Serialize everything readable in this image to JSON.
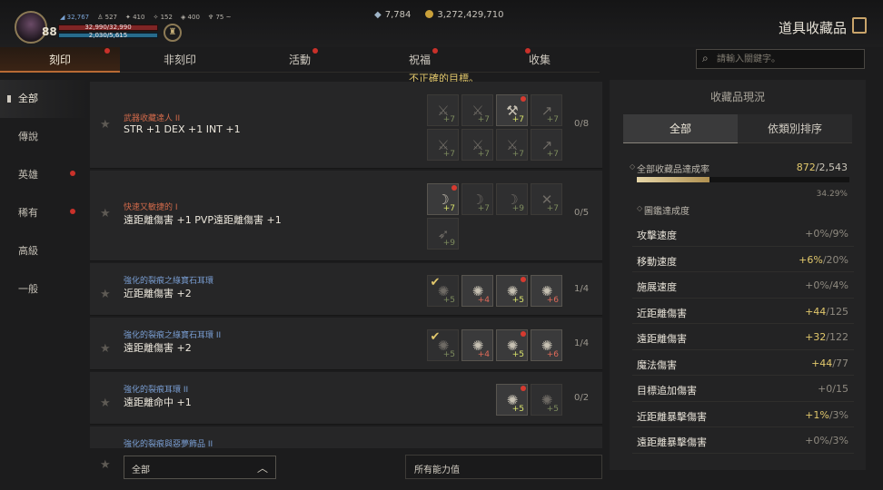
{
  "player": {
    "level": "88",
    "combat_power": "32,767",
    "stats": [
      "527",
      "410",
      "152",
      "400",
      "75 ~"
    ],
    "hp": "32,990/32,990",
    "mp": "2,030/5,615"
  },
  "currency": {
    "diamonds": "7,784",
    "gold": "3,272,429,710"
  },
  "page_title": "道具收藏品",
  "tabs": [
    {
      "label": "刻印",
      "active": true,
      "badge": true
    },
    {
      "label": "非刻印",
      "active": false,
      "badge": false
    },
    {
      "label": "活動",
      "active": false,
      "badge": true
    },
    {
      "label": "祝福",
      "active": false,
      "badge": true
    },
    {
      "label": "收集",
      "active": false,
      "badge": true
    }
  ],
  "search": {
    "placeholder": "請輸入關鍵字。"
  },
  "warning": "不正確的目標。",
  "categories": [
    {
      "label": "全部",
      "active": true,
      "badge": false
    },
    {
      "label": "傳說",
      "active": false,
      "badge": false
    },
    {
      "label": "英雄",
      "active": false,
      "badge": true
    },
    {
      "label": "稀有",
      "active": false,
      "badge": true
    },
    {
      "label": "高級",
      "active": false,
      "badge": false
    },
    {
      "label": "一般",
      "active": false,
      "badge": false
    }
  ],
  "collections": [
    {
      "name": "武器收藏達人 II",
      "name_color": "orange",
      "effect": "STR +1 DEX +1 INT +1",
      "count": "0/8",
      "items": [
        {
          "icon": "sword-icon",
          "bonus": "+7",
          "owned": false,
          "dot": false
        },
        {
          "icon": "sword-icon",
          "bonus": "+7",
          "owned": false,
          "dot": false
        },
        {
          "icon": "axe-icon",
          "bonus": "+7",
          "owned": true,
          "dot": true
        },
        {
          "icon": "spear-icon",
          "bonus": "+7",
          "owned": false,
          "dot": false
        },
        {
          "icon": "sword-icon",
          "bonus": "+7",
          "owned": false,
          "dot": false
        },
        {
          "icon": "sword-icon",
          "bonus": "+7",
          "owned": false,
          "dot": false
        },
        {
          "icon": "sword-icon",
          "bonus": "+7",
          "owned": false,
          "dot": false
        },
        {
          "icon": "spear-icon",
          "bonus": "+7",
          "owned": false,
          "dot": false
        }
      ]
    },
    {
      "name": "快速又敏捷的 I",
      "name_color": "orange",
      "effect": "遠距離傷害 +1 PVP遠距離傷害 +1",
      "count": "0/5",
      "items": [
        {
          "icon": "bow-icon",
          "bonus": "+7",
          "owned": true,
          "dot": true
        },
        {
          "icon": "bow-icon",
          "bonus": "+7",
          "owned": false,
          "dot": false
        },
        {
          "icon": "bow-icon",
          "bonus": "+9",
          "owned": false,
          "dot": false
        },
        {
          "icon": "crossbow-icon",
          "bonus": "+7",
          "owned": false,
          "dot": false
        },
        {
          "icon": "arrow-icon",
          "bonus": "+9",
          "owned": false,
          "dot": false
        }
      ]
    },
    {
      "name": "強化的裂痕之綠寶石耳環",
      "name_color": "blue",
      "effect": "近距離傷害 +2",
      "count": "1/4",
      "items": [
        {
          "icon": "earring-icon",
          "bonus": "+5",
          "owned": false,
          "dot": false,
          "red": false,
          "check": true
        },
        {
          "icon": "earring-icon",
          "bonus": "+4",
          "owned": true,
          "dot": false,
          "red": true
        },
        {
          "icon": "earring-icon",
          "bonus": "+5",
          "owned": true,
          "dot": true,
          "red": false
        },
        {
          "icon": "earring-icon",
          "bonus": "+6",
          "owned": true,
          "dot": false,
          "red": true
        }
      ]
    },
    {
      "name": "強化的裂痕之綠寶石耳環 II",
      "name_color": "blue",
      "effect": "遠距離傷害 +2",
      "count": "1/4",
      "items": [
        {
          "icon": "earring-icon",
          "bonus": "+5",
          "owned": false,
          "dot": false,
          "red": false,
          "check": true
        },
        {
          "icon": "earring-icon",
          "bonus": "+4",
          "owned": true,
          "dot": false,
          "red": true
        },
        {
          "icon": "earring-icon",
          "bonus": "+5",
          "owned": true,
          "dot": true,
          "red": false
        },
        {
          "icon": "earring-icon",
          "bonus": "+6",
          "owned": true,
          "dot": false,
          "red": true
        }
      ]
    },
    {
      "name": "強化的裂痕耳環 II",
      "name_color": "blue",
      "effect": "遠距離命中 +1",
      "count": "0/2",
      "items": [
        {
          "icon": "earring-icon",
          "bonus": "+5",
          "owned": true,
          "dot": true,
          "red": false
        },
        {
          "icon": "earring-icon",
          "bonus": "+5",
          "owned": false,
          "dot": false,
          "red": false
        }
      ]
    },
    {
      "name": "強化的裂痕與惡夢飾品 II",
      "name_color": "blue",
      "effect": "",
      "count": "",
      "items": []
    }
  ],
  "bottom": {
    "filter_value": "全部",
    "all_stats_label": "所有能力值"
  },
  "panel": {
    "title": "收藏品現況",
    "tabs": [
      {
        "label": "全部",
        "active": true
      },
      {
        "label": "依類別排序",
        "active": false
      }
    ],
    "achievement_label": "全部收藏品達成率",
    "achievement_done": "872",
    "achievement_total": "/2,543",
    "achievement_pct": "34.29%",
    "achievement_fraction": 0.3429,
    "catalog_label": "圖鑑達成度",
    "stats": [
      {
        "name": "攻擊速度",
        "current": "+0%",
        "max": "/9%",
        "highlight": false
      },
      {
        "name": "移動速度",
        "current": "+6%",
        "max": "/20%",
        "highlight": true
      },
      {
        "name": "施展速度",
        "current": "+0%",
        "max": "/4%",
        "highlight": false
      },
      {
        "name": "近距離傷害",
        "current": "+44",
        "max": "/125",
        "highlight": true
      },
      {
        "name": "遠距離傷害",
        "current": "+32",
        "max": "/122",
        "highlight": true
      },
      {
        "name": "魔法傷害",
        "current": "+44",
        "max": "/77",
        "highlight": true
      },
      {
        "name": "目標追加傷害",
        "current": "+0",
        "max": "/15",
        "highlight": false
      },
      {
        "name": "近距離暴擊傷害",
        "current": "+1%",
        "max": "/3%",
        "highlight": true
      },
      {
        "name": "遠距離暴擊傷害",
        "current": "+0%",
        "max": "/3%",
        "highlight": false
      }
    ]
  },
  "colors": {
    "accent": "#b86a34",
    "gold": "#e2c86c",
    "badge": "#c9312a"
  }
}
